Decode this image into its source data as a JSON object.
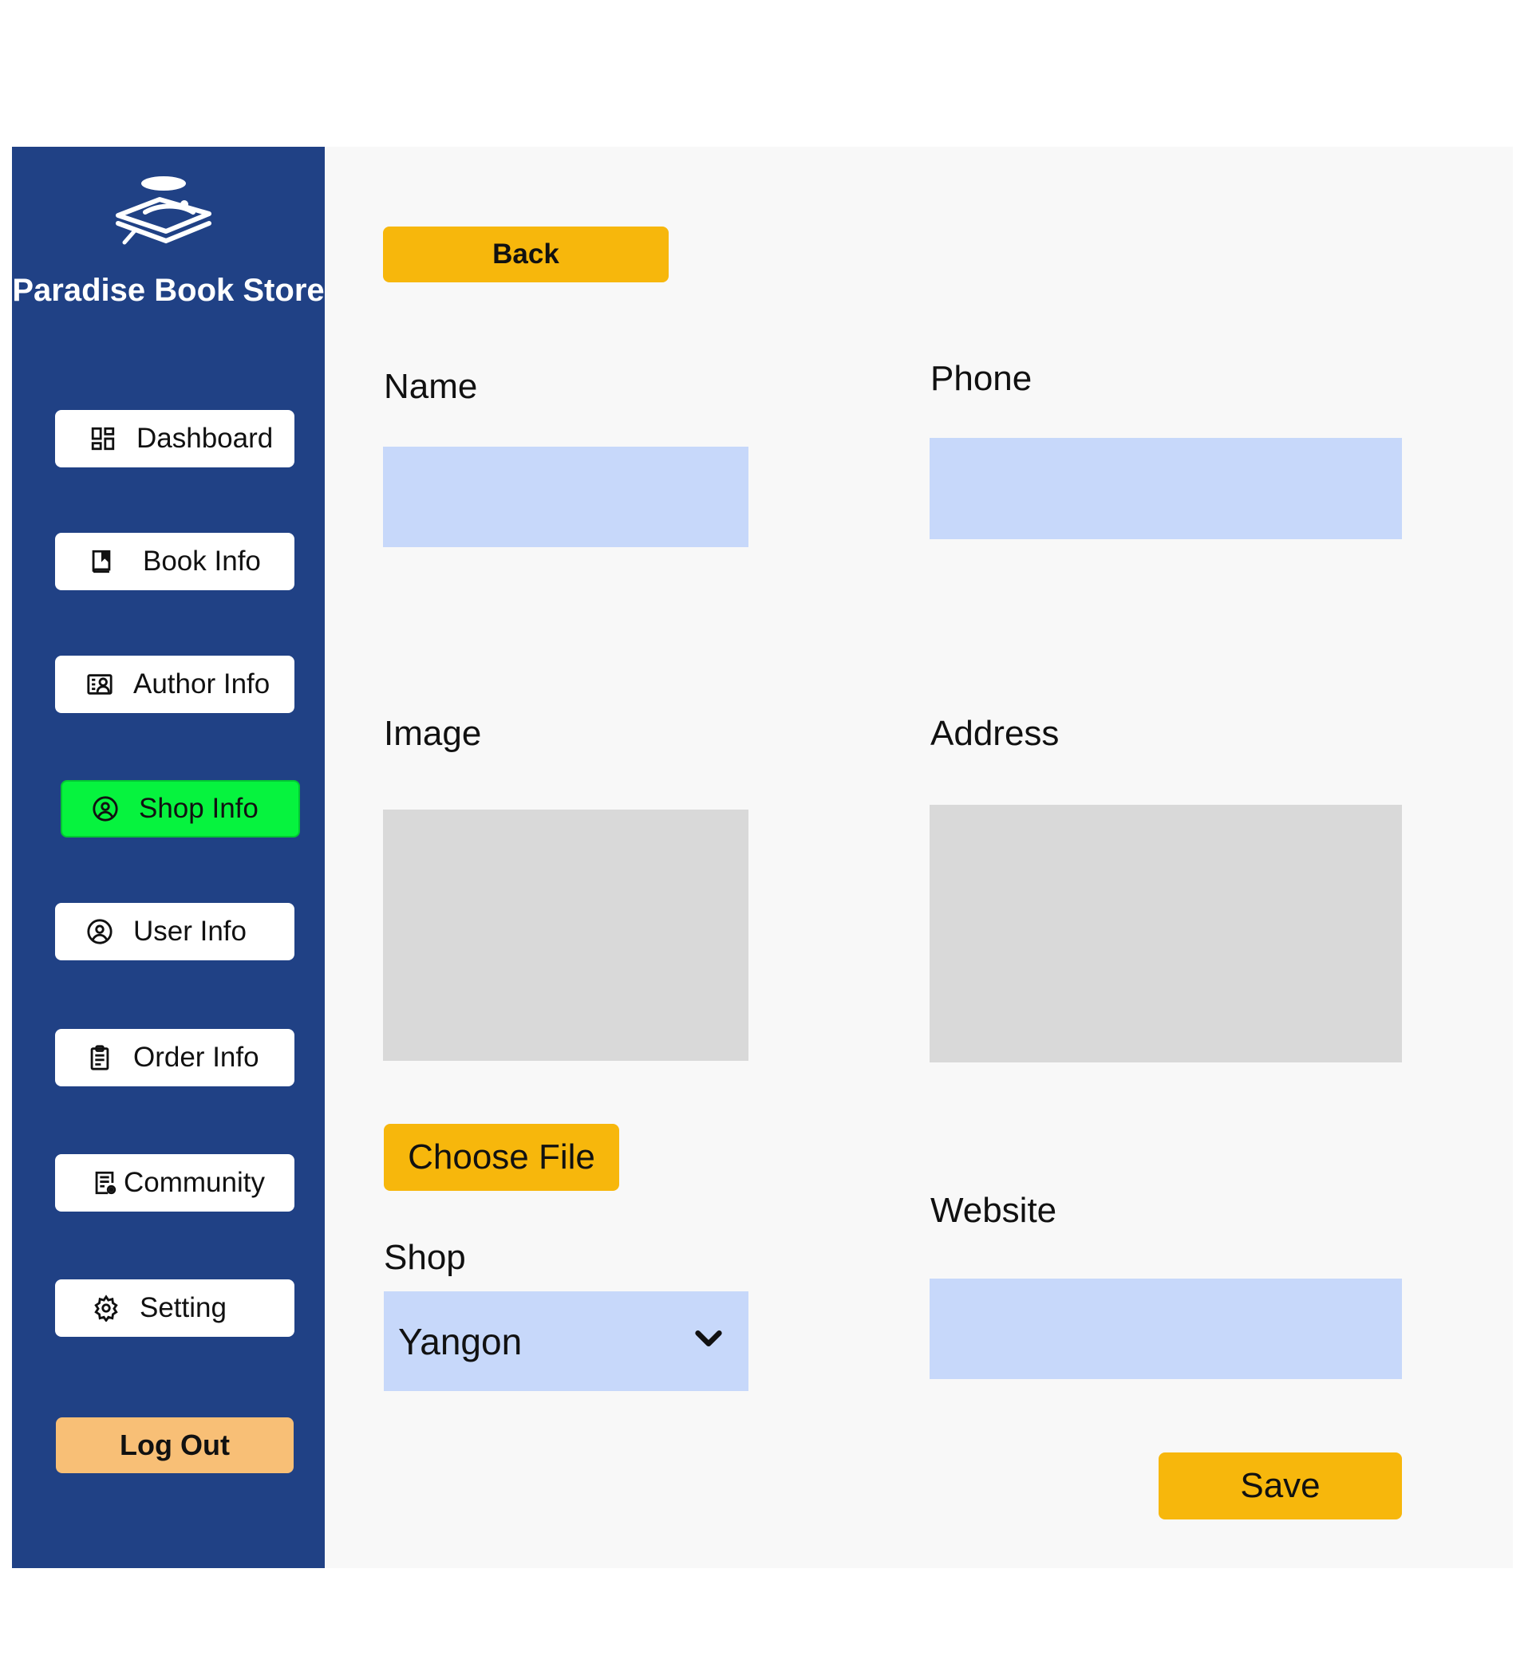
{
  "sidebar": {
    "brand_title": "Paradise Book Store",
    "logo_icon": "book-stack-logo-icon",
    "items": [
      {
        "label": "Dashboard",
        "icon": "dashboard-grid-icon",
        "active": false
      },
      {
        "label": "Book Info",
        "icon": "book-icon",
        "active": false
      },
      {
        "label": "Author Info",
        "icon": "id-card-icon",
        "active": false
      },
      {
        "label": "Shop Info",
        "icon": "user-circle-icon",
        "active": true
      },
      {
        "label": "User Info",
        "icon": "user-circle-icon",
        "active": false
      },
      {
        "label": "Order Info",
        "icon": "clipboard-icon",
        "active": false
      },
      {
        "label": "Community",
        "icon": "document-eye-icon",
        "active": false
      },
      {
        "label": "Setting",
        "icon": "gear-icon",
        "active": false
      }
    ],
    "logout_label": "Log Out"
  },
  "form": {
    "back_label": "Back",
    "name_label": "Name",
    "name_value": "",
    "phone_label": "Phone",
    "phone_value": "",
    "image_label": "Image",
    "address_label": "Address",
    "choose_file_label": "Choose File",
    "shop_label": "Shop",
    "shop_selected": "Yangon",
    "website_label": "Website",
    "website_value": "",
    "save_label": "Save"
  },
  "colors": {
    "sidebar_bg": "#204185",
    "accent_yellow": "#f7b70c",
    "active_green": "#06f33e",
    "logout_orange": "#f8bf76",
    "input_blue": "#c7d8fa",
    "placeholder_gray": "#d9d9d9"
  }
}
